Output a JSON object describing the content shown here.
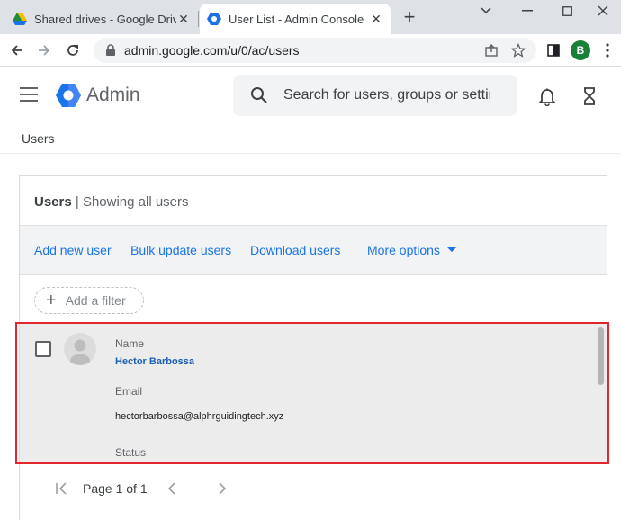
{
  "browser": {
    "tabs": [
      {
        "title": "Shared drives - Google Drive",
        "active": false
      },
      {
        "title": "User List - Admin Console",
        "active": true
      }
    ],
    "url": "admin.google.com/u/0/ac/users",
    "profile_initial": "B",
    "profile_color": "#188038"
  },
  "header": {
    "brand": "Admin",
    "search_placeholder": "Search for users, groups or settings"
  },
  "breadcrumb": "Users",
  "card": {
    "title_bold": "Users",
    "title_sep": " | ",
    "title_rest": "Showing all users",
    "actions": {
      "add_new_user": "Add new user",
      "bulk_update": "Bulk update users",
      "download": "Download users",
      "more_options": "More options"
    },
    "filter_label": "Add a filter"
  },
  "user": {
    "name_label": "Name",
    "name": "Hector Barbossa",
    "email_label": "Email",
    "email": "hectorbarbossa@alphrguidingtech.xyz",
    "status_label": "Status"
  },
  "pagination": {
    "label": "Page 1 of 1"
  },
  "colors": {
    "accent": "#1a73e8",
    "highlight_border": "#e3262c"
  }
}
